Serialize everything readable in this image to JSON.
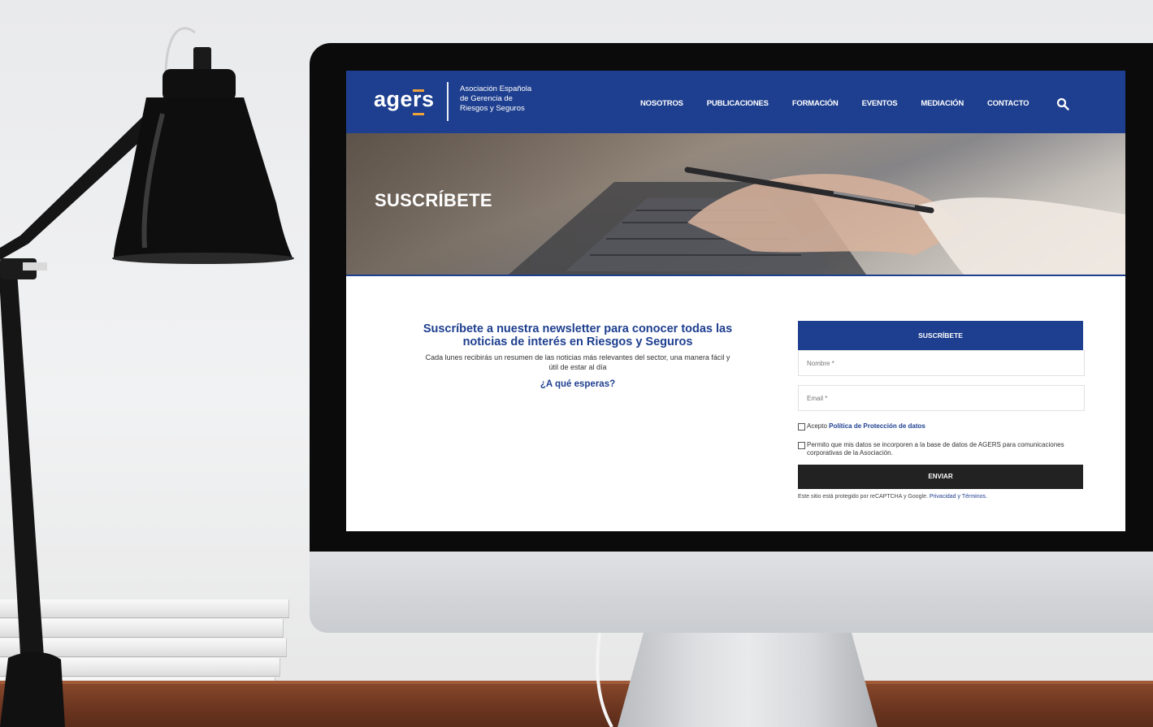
{
  "site": {
    "logo": {
      "wordmark": "agers",
      "tagline": [
        "Asociación Española",
        "de Gerencia de",
        "Riesgos y Seguros"
      ]
    },
    "nav": [
      "NOSOTROS",
      "PUBLICACIONES",
      "FORMACIÓN",
      "EVENTOS",
      "MEDIACIÓN",
      "CONTACTO"
    ],
    "search_icon": "search-icon"
  },
  "hero": {
    "title": "SUSCRÍBETE"
  },
  "intro": {
    "title": "Suscríbete a nuestra newsletter para conocer todas las noticias de interés en Riesgos y Seguros",
    "text": "Cada lunes recibirás un resumen de las noticias más relevantes del sector, una manera fácil y útil de estar al día",
    "cta": "¿A qué esperas?"
  },
  "form": {
    "header": "SUSCRÍBETE",
    "name_placeholder": "Nombre *",
    "email_placeholder": "Email *",
    "accept_prefix": "Acepto",
    "accept_link": "Política de Protección de datos",
    "consent_text": "Permito que mis datos se incorporen a la base de datos de AGERS para comunicaciones corporativas de la Asociación.",
    "submit_label": "ENVIAR",
    "recaptcha_text": "Este sitio está protegido por reCAPTCHA y Google.",
    "recaptcha_link": "Privacidad y Términos."
  },
  "colors": {
    "brand_blue": "#1e3f8f",
    "accent_orange": "#f0a23a",
    "button_dark": "#222222"
  }
}
